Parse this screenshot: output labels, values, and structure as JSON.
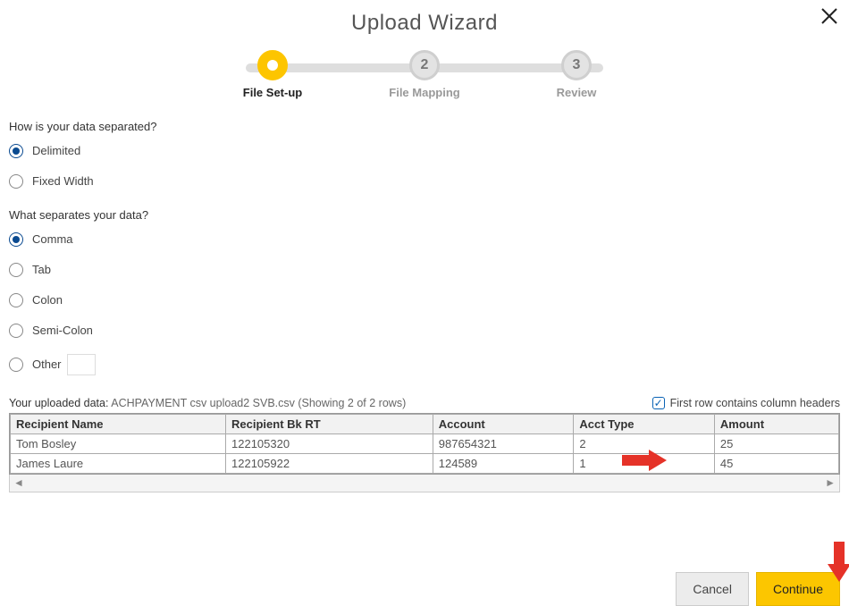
{
  "title": "Upload Wizard",
  "steps": [
    {
      "label": "File Set-up",
      "active": true,
      "num": "1"
    },
    {
      "label": "File Mapping",
      "active": false,
      "num": "2"
    },
    {
      "label": "Review",
      "active": false,
      "num": "3"
    }
  ],
  "q1": {
    "label": "How is your data separated?",
    "options": {
      "delimited": "Delimited",
      "fixed": "Fixed Width"
    },
    "selected": "delimited"
  },
  "q2": {
    "label": "What separates your data?",
    "options": {
      "comma": "Comma",
      "tab": "Tab",
      "colon": "Colon",
      "semicolon": "Semi-Colon",
      "other": "Other"
    },
    "selected": "comma"
  },
  "upload": {
    "prefix": "Your uploaded data:",
    "filename": "ACHPAYMENT csv upload2 SVB.csv (Showing 2 of 2 rows)",
    "headerCheckboxLabel": "First row contains column headers",
    "headerCheckboxChecked": true
  },
  "table": {
    "columns": [
      "Recipient Name",
      "Recipient Bk RT",
      "Account",
      "Acct Type",
      "Amount"
    ],
    "rows": [
      [
        "Tom Bosley",
        "122105320",
        "987654321",
        "2",
        "25"
      ],
      [
        "James Laure",
        "122105922",
        "124589",
        "1",
        "45"
      ]
    ]
  },
  "buttons": {
    "cancel": "Cancel",
    "continue": "Continue"
  }
}
